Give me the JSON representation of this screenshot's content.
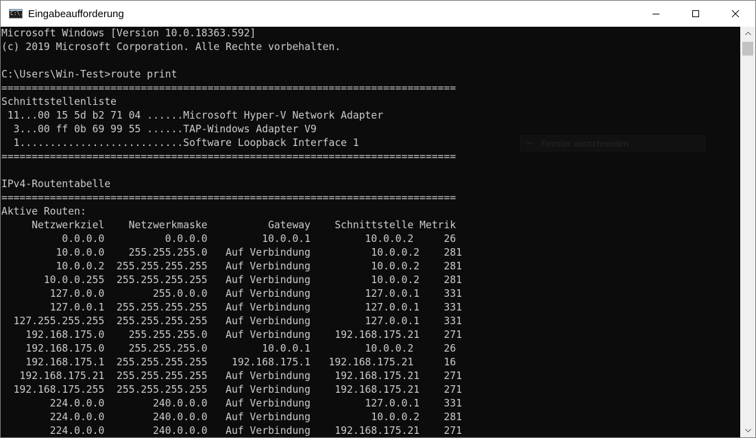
{
  "window": {
    "title": "Eingabeaufforderung",
    "icon": "cmd-icon",
    "icon_text": "C:\\."
  },
  "controls": {
    "minimize": "minimize-icon",
    "maximize": "maximize-icon",
    "close": "close-icon"
  },
  "console": {
    "lines": [
      "Microsoft Windows [Version 10.0.18363.592]",
      "(c) 2019 Microsoft Corporation. Alle Rechte vorbehalten.",
      "",
      "C:\\Users\\Win-Test>route print",
      "===========================================================================",
      "Schnittstellenliste",
      " 11...00 15 5d b2 71 04 ......Microsoft Hyper-V Network Adapter",
      "  3...00 ff 0b 69 99 55 ......TAP-Windows Adapter V9",
      "  1...........................Software Loopback Interface 1",
      "===========================================================================",
      "",
      "IPv4-Routentabelle",
      "===========================================================================",
      "Aktive Routen:",
      "     Netzwerkziel    Netzwerkmaske          Gateway    Schnittstelle Metrik",
      "          0.0.0.0          0.0.0.0         10.0.0.1         10.0.0.2     26",
      "         10.0.0.0    255.255.255.0   Auf Verbindung          10.0.0.2    281",
      "         10.0.0.2  255.255.255.255   Auf Verbindung          10.0.0.2    281",
      "       10.0.0.255  255.255.255.255   Auf Verbindung          10.0.0.2    281",
      "        127.0.0.0        255.0.0.0   Auf Verbindung         127.0.0.1    331",
      "        127.0.0.1  255.255.255.255   Auf Verbindung         127.0.0.1    331",
      "  127.255.255.255  255.255.255.255   Auf Verbindung         127.0.0.1    331",
      "    192.168.175.0    255.255.255.0   Auf Verbindung    192.168.175.21    271",
      "    192.168.175.0    255.255.255.0         10.0.0.1         10.0.0.2     26",
      "    192.168.175.1  255.255.255.255    192.168.175.1   192.168.175.21     16",
      "   192.168.175.21  255.255.255.255   Auf Verbindung    192.168.175.21    271",
      "  192.168.175.255  255.255.255.255   Auf Verbindung    192.168.175.21    271",
      "        224.0.0.0        240.0.0.0   Auf Verbindung         127.0.0.1    331",
      "        224.0.0.0        240.0.0.0   Auf Verbindung          10.0.0.2    281",
      "        224.0.0.0        240.0.0.0   Auf Verbindung    192.168.175.21    271"
    ]
  },
  "tooltip": {
    "icon": "scissors-icon",
    "text": "Fenster ausschneiden"
  },
  "colors": {
    "console_bg": "#0c0c0c",
    "console_fg": "#cccccc",
    "titlebar_bg": "#ffffff"
  }
}
